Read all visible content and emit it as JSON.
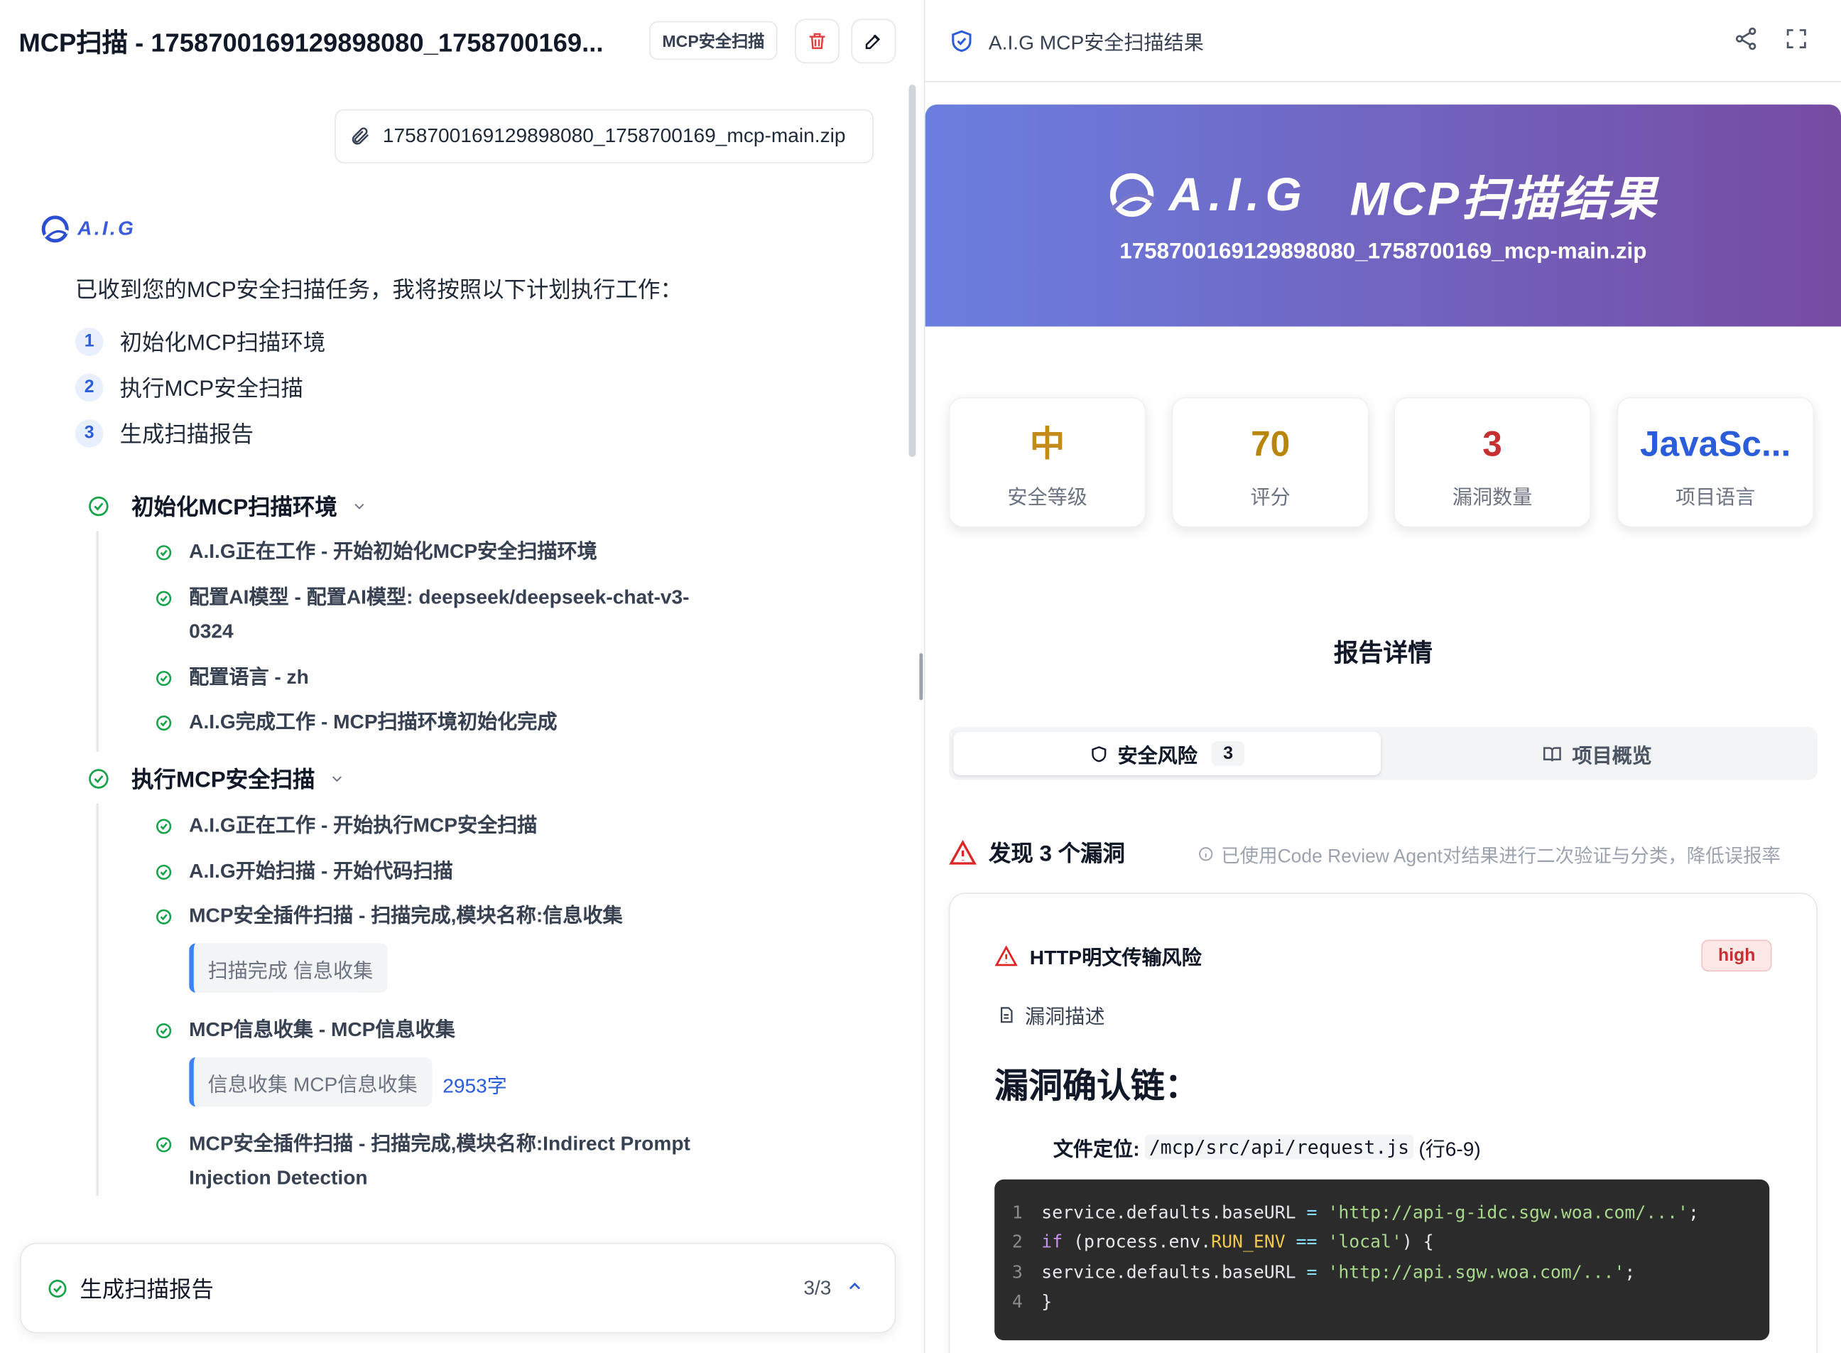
{
  "left": {
    "title": "MCP扫描 - 1758700169129898080_1758700169...",
    "tag_label": "MCP安全扫描",
    "file_name": "1758700169129898080_1758700169_mcp-main.zip",
    "logo_text": "A.I.G",
    "intro": "已收到您的MCP安全扫描任务，我将按照以下计划执行工作：",
    "plan": [
      {
        "num": "1",
        "label": "初始化MCP扫描环境"
      },
      {
        "num": "2",
        "label": "执行MCP安全扫描"
      },
      {
        "num": "3",
        "label": "生成扫描报告"
      }
    ],
    "steps": [
      {
        "title": "初始化MCP扫描环境",
        "items": [
          {
            "text": "A.I.G正在工作 - 开始初始化MCP安全扫描环境"
          },
          {
            "text": "配置AI模型 - 配置AI模型: deepseek/deepseek-chat-v3-0324"
          },
          {
            "text": "配置语言 - zh"
          },
          {
            "text": "A.I.G完成工作 - MCP扫描环境初始化完成"
          }
        ]
      },
      {
        "title": "执行MCP安全扫描",
        "items": [
          {
            "text": "A.I.G正在工作 - 开始执行MCP安全扫描"
          },
          {
            "text": "A.I.G开始扫描 - 开始代码扫描"
          },
          {
            "text": "MCP安全插件扫描 - 扫描完成,模块名称:信息收集",
            "quote": "扫描完成 信息收集"
          },
          {
            "text": "MCP信息收集 - MCP信息收集",
            "quote": "信息收集 MCP信息收集",
            "word_count": "2953字"
          },
          {
            "text": "MCP安全插件扫描 - 扫描完成,模块名称:Indirect Prompt Injection Detection"
          }
        ]
      }
    ],
    "bottom": {
      "label": "生成扫描报告",
      "count": "3/3"
    }
  },
  "right": {
    "header_title": "A.I.G MCP安全扫描结果",
    "banner": {
      "logo_text": "A.I.G",
      "title": "MCP扫描结果",
      "file_name": "1758700169129898080_1758700169_mcp-main.zip"
    },
    "stats": [
      {
        "value": "中",
        "label": "安全等级",
        "color": "#c48a1c"
      },
      {
        "value": "70",
        "label": "评分",
        "color": "#b8860b"
      },
      {
        "value": "3",
        "label": "漏洞数量",
        "color": "#c53030"
      },
      {
        "value": "JavaSc...",
        "label": "项目语言",
        "color": "#2b5cd9"
      }
    ],
    "section_title": "报告详情",
    "tabs": [
      {
        "label": "安全风险",
        "badge": "3"
      },
      {
        "label": "项目概览"
      }
    ],
    "found_title": "发现 3 个漏洞",
    "note": "已使用Code Review Agent对结果进行二次验证与分类，降低误报率",
    "vuln": {
      "title": "HTTP明文传输风险",
      "severity": "high",
      "desc_label": "漏洞描述",
      "heading": "漏洞确认链：",
      "loc_label": "文件定位:",
      "loc_path": "/mcp/src/api/request.js",
      "loc_range": "(行6-9)",
      "code_lines": [
        {
          "no": "1",
          "a": "service.defaults.baseURL ",
          "op": "=",
          "str": " 'http://api-g-idc.sgw.woa.com/...'",
          "end": ";"
        },
        {
          "no": "2",
          "kw": "if",
          "a": " (process.env.",
          "vr": "RUN_ENV",
          "op": " ==",
          "str": " 'local'",
          "end": ") {"
        },
        {
          "no": "3",
          "a": "service.defaults.baseURL ",
          "op": "=",
          "str": " 'http://api.sgw.woa.com/...'",
          "end": ";"
        },
        {
          "no": "4",
          "a": "}"
        }
      ]
    }
  }
}
